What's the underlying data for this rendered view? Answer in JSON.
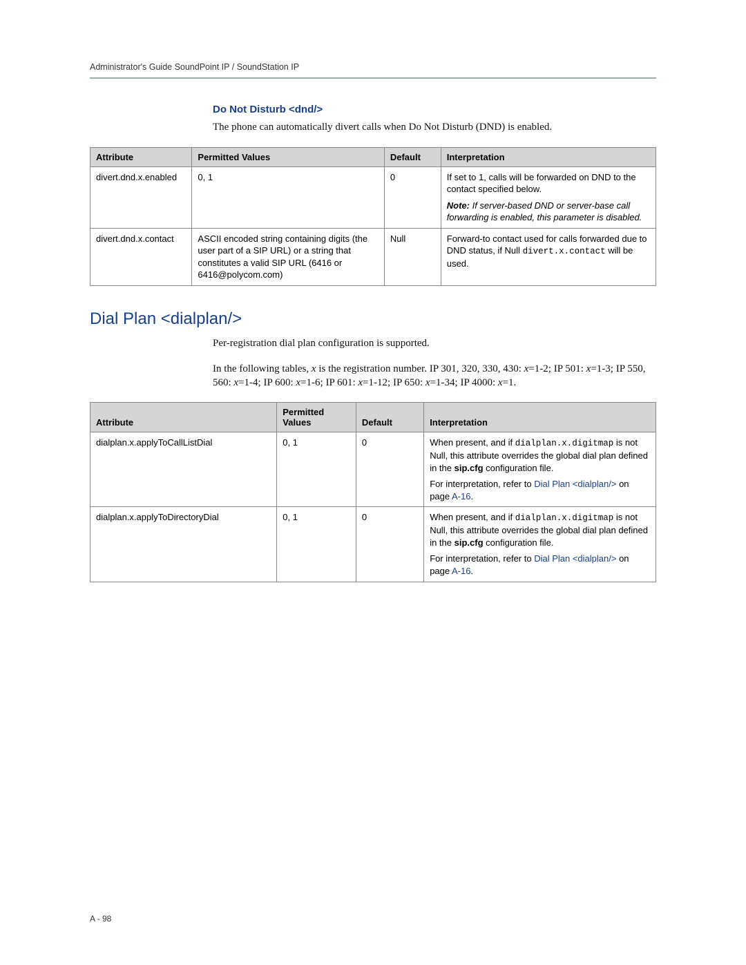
{
  "header": {
    "running": "Administrator's Guide SoundPoint IP / SoundStation IP"
  },
  "section_dnd": {
    "heading": "Do Not Disturb <dnd/>",
    "para": "The phone can automatically divert calls when Do Not Disturb (DND) is enabled.",
    "table": {
      "headers": {
        "attribute": "Attribute",
        "permitted": "Permitted Values",
        "default": "Default",
        "interpretation": "Interpretation"
      },
      "rows": [
        {
          "attribute": "divert.dnd.x.enabled",
          "permitted": "0, 1",
          "default": "0",
          "interp_plain": "If set to 1, calls will be forwarded on DND to the contact specified below.",
          "interp_note_label": "Note:",
          "interp_note_body": " If server-based DND or server-base call forwarding is enabled, this parameter is disabled."
        },
        {
          "attribute": "divert.dnd.x.contact",
          "permitted": "ASCII encoded string containing digits (the user part of a SIP URL) or a string that constitutes a valid SIP URL (6416 or 6416@polycom.com)",
          "default": "Null",
          "interp_pre": "Forward-to contact used for calls forwarded due to DND status, if Null ",
          "interp_code": "divert.x.contact",
          "interp_post": " will be used."
        }
      ]
    }
  },
  "section_dialplan": {
    "heading": "Dial Plan <dialplan/>",
    "para1": "Per-registration dial plan configuration is supported.",
    "para2_a": "In the following tables, ",
    "para2_x": "x",
    "para2_b": " is the registration number. IP 301, 320, 330, 430: ",
    "para2_c": "=1-2; IP 501: ",
    "para2_d": "=1-3; IP 550, 560: ",
    "para2_e": "=1-4; IP 600: ",
    "para2_f": "=1-6; IP 601: ",
    "para2_g": "=1-12; IP 650: ",
    "para2_h": "=1-34; IP 4000: ",
    "para2_i": "=1.",
    "table": {
      "headers": {
        "attribute": "Attribute",
        "permitted": "Permitted Values",
        "default": "Default",
        "interpretation": "Interpretation"
      },
      "rows": [
        {
          "attribute": "dialplan.x.applyToCallListDial",
          "permitted": "0, 1",
          "default": "0",
          "interp": {
            "p1_a": "When present, and if ",
            "p1_code": "dialplan.x.digitmap",
            "p1_b": " is not Null, this attribute overrides the global dial plan defined in the ",
            "p1_bold": "sip.cfg",
            "p1_c": " configuration file.",
            "p2_a": "For interpretation, refer to ",
            "p2_link1": "Dial Plan <dialplan/>",
            "p2_b": " on page ",
            "p2_link2": "A-16",
            "p2_c": "."
          }
        },
        {
          "attribute": "dialplan.x.applyToDirectoryDial",
          "permitted": "0, 1",
          "default": "0",
          "interp": {
            "p1_a": "When present, and if ",
            "p1_code": "dialplan.x.digitmap",
            "p1_b": " is not Null, this attribute overrides the global dial plan defined in the ",
            "p1_bold": "sip.cfg",
            "p1_c": " configuration file.",
            "p2_a": "For interpretation, refer to ",
            "p2_link1": "Dial Plan <dialplan/>",
            "p2_b": " on page ",
            "p2_link2": "A-16",
            "p2_c": "."
          }
        }
      ]
    }
  },
  "footer": {
    "page_number": "A - 98"
  }
}
